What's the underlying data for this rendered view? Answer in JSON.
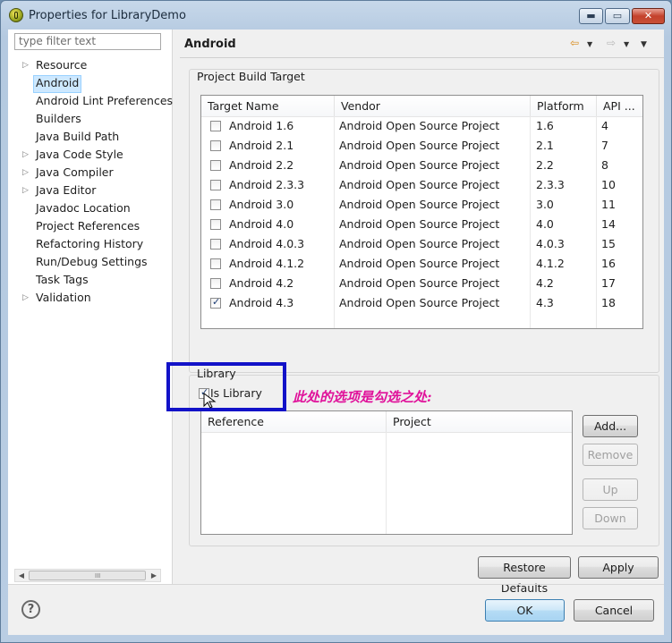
{
  "window": {
    "title": "Properties for LibraryDemo"
  },
  "filter": {
    "placeholder": "type filter text"
  },
  "tree": [
    {
      "label": "Resource",
      "expandable": true
    },
    {
      "label": "Android",
      "selected": true
    },
    {
      "label": "Android Lint Preferences"
    },
    {
      "label": "Builders"
    },
    {
      "label": "Java Build Path"
    },
    {
      "label": "Java Code Style",
      "expandable": true
    },
    {
      "label": "Java Compiler",
      "expandable": true
    },
    {
      "label": "Java Editor",
      "expandable": true
    },
    {
      "label": "Javadoc Location"
    },
    {
      "label": "Project References"
    },
    {
      "label": "Refactoring History"
    },
    {
      "label": "Run/Debug Settings"
    },
    {
      "label": "Task Tags"
    },
    {
      "label": "Validation",
      "expandable": true
    }
  ],
  "page": {
    "title": "Android"
  },
  "build_target": {
    "label": "Project Build Target",
    "columns": [
      "Target Name",
      "Vendor",
      "Platform",
      "API ..."
    ],
    "rows": [
      {
        "name": "Android 1.6",
        "vendor": "Android Open Source Project",
        "platform": "1.6",
        "api": "4",
        "checked": false
      },
      {
        "name": "Android 2.1",
        "vendor": "Android Open Source Project",
        "platform": "2.1",
        "api": "7",
        "checked": false
      },
      {
        "name": "Android 2.2",
        "vendor": "Android Open Source Project",
        "platform": "2.2",
        "api": "8",
        "checked": false
      },
      {
        "name": "Android 2.3.3",
        "vendor": "Android Open Source Project",
        "platform": "2.3.3",
        "api": "10",
        "checked": false
      },
      {
        "name": "Android 3.0",
        "vendor": "Android Open Source Project",
        "platform": "3.0",
        "api": "11",
        "checked": false
      },
      {
        "name": "Android 4.0",
        "vendor": "Android Open Source Project",
        "platform": "4.0",
        "api": "14",
        "checked": false
      },
      {
        "name": "Android 4.0.3",
        "vendor": "Android Open Source Project",
        "platform": "4.0.3",
        "api": "15",
        "checked": false
      },
      {
        "name": "Android 4.1.2",
        "vendor": "Android Open Source Project",
        "platform": "4.1.2",
        "api": "16",
        "checked": false
      },
      {
        "name": "Android 4.2",
        "vendor": "Android Open Source Project",
        "platform": "4.2",
        "api": "17",
        "checked": false
      },
      {
        "name": "Android 4.3",
        "vendor": "Android Open Source Project",
        "platform": "4.3",
        "api": "18",
        "checked": true
      }
    ]
  },
  "library": {
    "label": "Library",
    "is_library_label": "Is Library",
    "is_library_checked": true,
    "columns": [
      "Reference",
      "Project"
    ],
    "add_label": "Add...",
    "remove_label": "Remove",
    "up_label": "Up",
    "down_label": "Down"
  },
  "annotation": {
    "text": "此处的选项是勾选之处:",
    "color": "#e0119a",
    "box_color": "#1212c8"
  },
  "buttons": {
    "restore_defaults": "Restore Defaults",
    "apply": "Apply",
    "ok": "OK",
    "cancel": "Cancel",
    "help": "?"
  },
  "window_controls": {
    "minimize": "▬",
    "maximize": "▭",
    "close": "✕"
  },
  "scroll_grip": "III"
}
